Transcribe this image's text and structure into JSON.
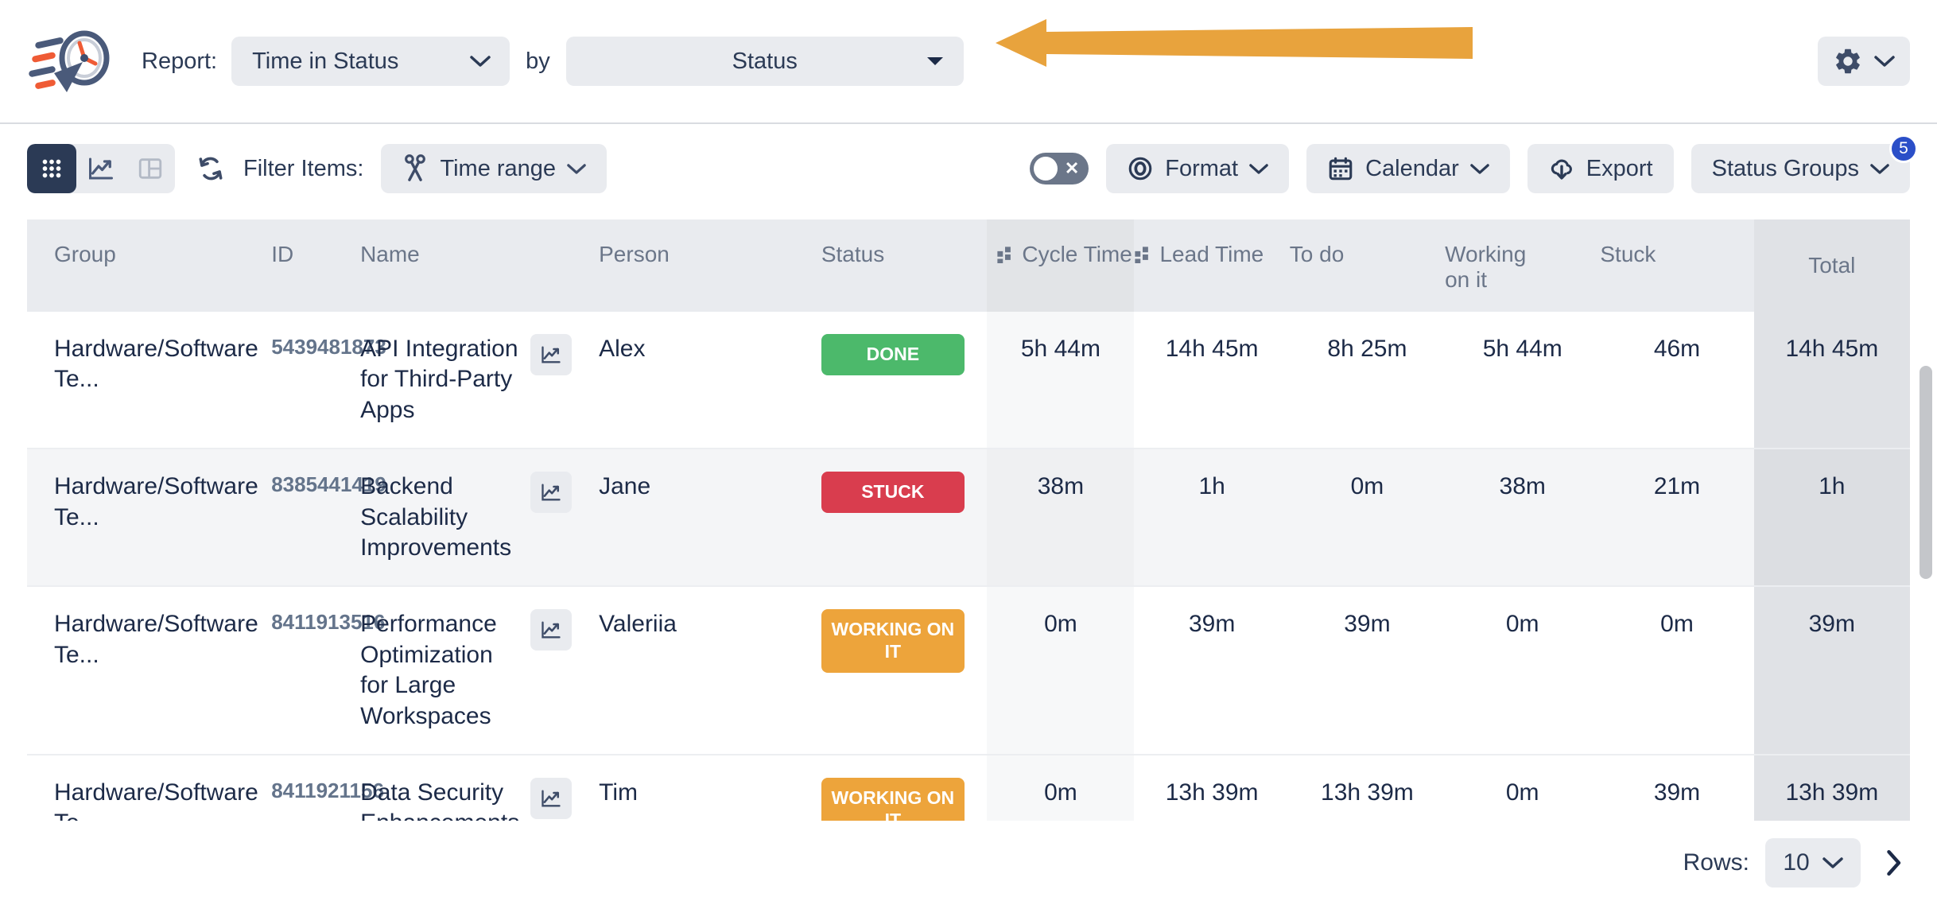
{
  "header": {
    "report_label": "Report:",
    "report_value": "Time in Status",
    "by_label": "by",
    "by_value": "Status",
    "gear_icon": "gear-icon",
    "caret_icon": "chevron-down-icon",
    "annotation": "orange-left-arrow"
  },
  "toolbar": {
    "views": [
      {
        "icon": "grid-view-icon",
        "active": true
      },
      {
        "icon": "chart-view-icon",
        "active": false
      },
      {
        "icon": "board-view-icon",
        "active": false
      }
    ],
    "refresh_icon": "refresh-icon",
    "filter_label": "Filter Items:",
    "time_range_label": "Time range",
    "time_range_icon": "scissors-icon",
    "toggle_state": "off",
    "toggle_icon": "toggle-off-x-icon",
    "buttons": [
      {
        "label": "Format",
        "icon": "target-eye-icon",
        "caret": true,
        "badge": null
      },
      {
        "label": "Calendar",
        "icon": "calendar-icon",
        "caret": true,
        "badge": null
      },
      {
        "label": "Export",
        "icon": "cloud-download-icon",
        "caret": false,
        "badge": null
      },
      {
        "label": "Status Groups",
        "icon": null,
        "caret": true,
        "badge": "5"
      }
    ]
  },
  "table": {
    "columns": [
      {
        "key": "group",
        "label": "Group",
        "handle": false
      },
      {
        "key": "id",
        "label": "ID",
        "handle": false
      },
      {
        "key": "name",
        "label": "Name",
        "handle": false
      },
      {
        "key": "person",
        "label": "Person",
        "handle": false
      },
      {
        "key": "status",
        "label": "Status",
        "handle": false
      },
      {
        "key": "cycle",
        "label": "Cycle Time",
        "handle": true
      },
      {
        "key": "lead",
        "label": "Lead Time",
        "handle": true
      },
      {
        "key": "todo",
        "label": "To do",
        "handle": false
      },
      {
        "key": "working",
        "label": "Working on it",
        "handle": false
      },
      {
        "key": "stuck",
        "label": "Stuck",
        "handle": false
      },
      {
        "key": "total",
        "label": "Total",
        "handle": false
      }
    ],
    "rows": [
      {
        "group": "Hardware/Software Te...",
        "id": "5439481873",
        "name": "API Integration for Third-Party Apps",
        "person": "Alex",
        "status": "DONE",
        "status_color": "#4cb96b",
        "cycle": "5h 44m",
        "lead": "14h 45m",
        "todo": "8h 25m",
        "working": "5h 44m",
        "stuck": "46m",
        "total": "14h 45m"
      },
      {
        "group": "Hardware/Software Te...",
        "id": "8385441419",
        "name": "Backend Scalability Improvements",
        "person": "Jane",
        "status": "STUCK",
        "status_color": "#d93d4e",
        "cycle": "38m",
        "lead": "1h",
        "todo": "0m",
        "working": "38m",
        "stuck": "21m",
        "total": "1h"
      },
      {
        "group": "Hardware/Software Te...",
        "id": "8411913516",
        "name": "Performance Optimization for Large Workspaces",
        "person": "Valeriia",
        "status": "WORKING ON IT",
        "status_color": "#eda43b",
        "cycle": "0m",
        "lead": "39m",
        "todo": "39m",
        "working": "0m",
        "stuck": "0m",
        "total": "39m"
      },
      {
        "group": "Hardware/Software Te...",
        "id": "8411921156",
        "name": "Data Security Enhancements",
        "person": "Tim",
        "status": "WORKING ON IT",
        "status_color": "#eda43b",
        "cycle": "0m",
        "lead": "13h 39m",
        "todo": "13h 39m",
        "working": "0m",
        "stuck": "39m",
        "total": "13h 39m"
      }
    ]
  },
  "footer": {
    "rows_label": "Rows:",
    "rows_value": "10",
    "next_icon": "chevron-right-icon"
  },
  "colors": {
    "accent": "#2b3a55",
    "badge_blue": "#2b4fc8",
    "annotation_orange": "#e8a33d",
    "done_green": "#4cb96b",
    "stuck_red": "#d93d4e",
    "working_orange": "#eda43b"
  }
}
